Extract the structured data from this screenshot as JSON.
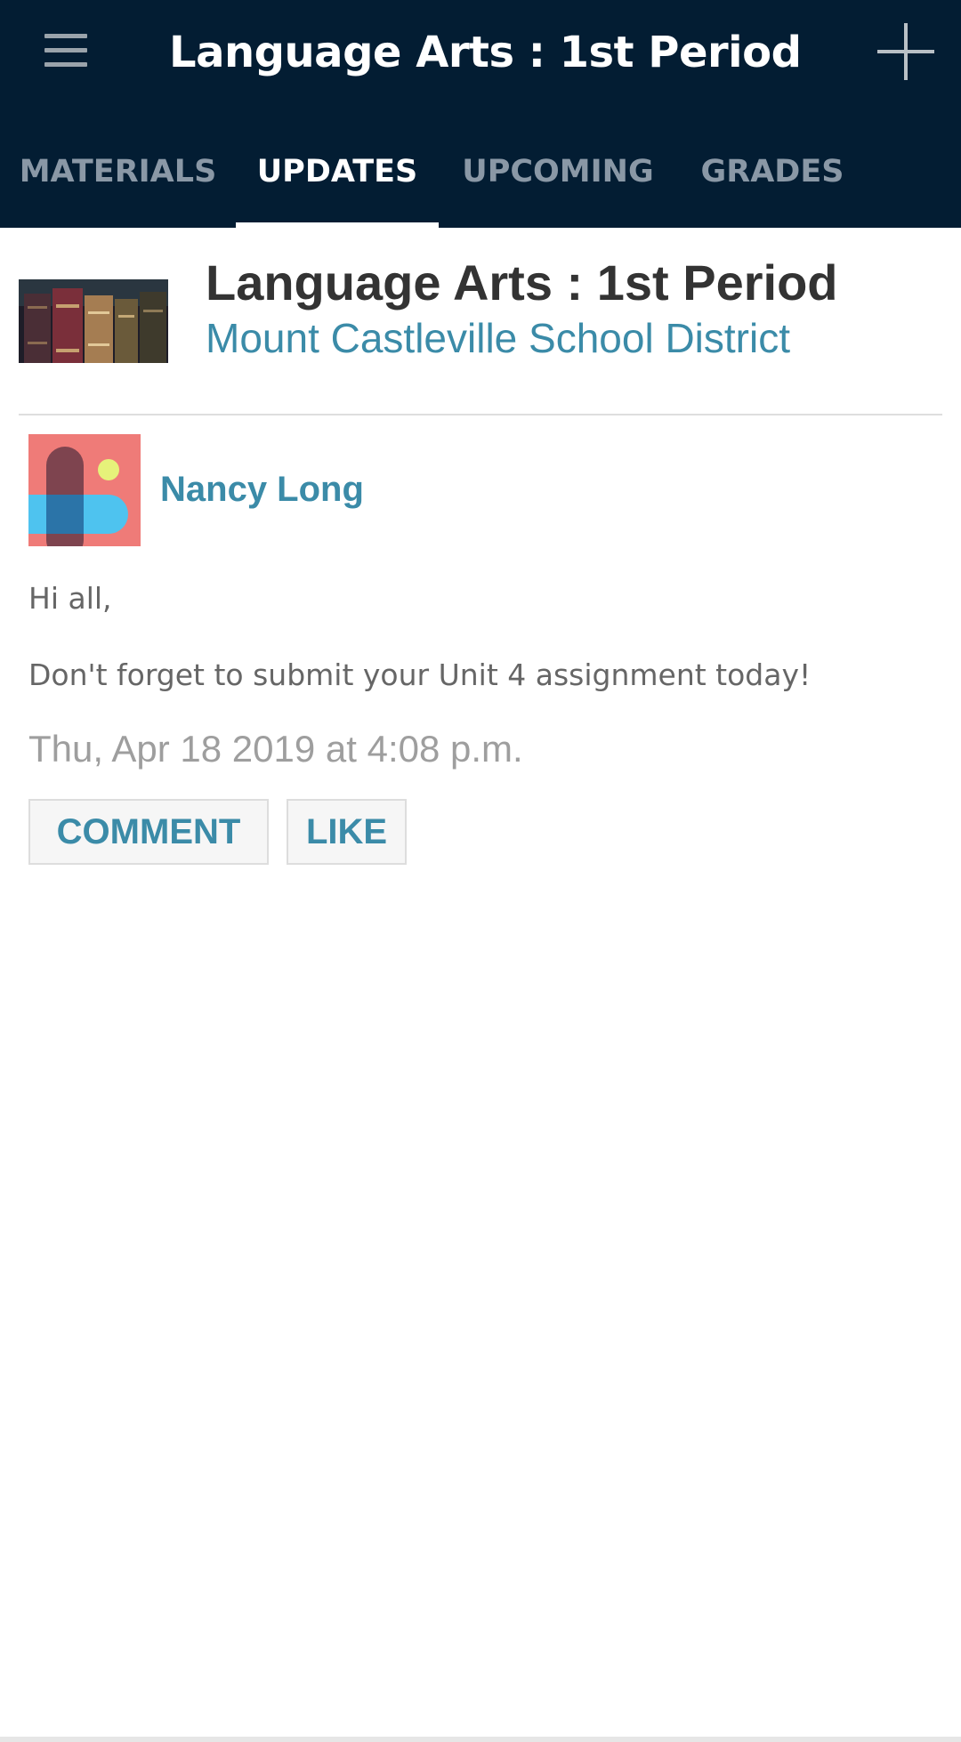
{
  "colors": {
    "app_bar": "#031d33",
    "accent": "#3b8ba8",
    "tab_inactive": "#8a98a6",
    "tab_active": "#ffffff",
    "body_text": "#666666",
    "timestamp": "#9e9e9e",
    "title_text": "#333333"
  },
  "toolbar": {
    "title": "Language Arts : 1st Period",
    "menu_icon": "hamburger-menu-icon",
    "add_icon": "plus-icon"
  },
  "tabs": [
    {
      "label": "MATERIALS",
      "active": false
    },
    {
      "label": "UPDATES",
      "active": true
    },
    {
      "label": "UPCOMING",
      "active": false
    },
    {
      "label": "GRADES",
      "active": false
    }
  ],
  "course": {
    "title": "Language Arts : 1st Period",
    "subtitle": "Mount Castleville School District",
    "thumbnail": "books-image"
  },
  "post": {
    "author": "Nancy Long",
    "avatar": "author-avatar-image",
    "greeting": "Hi all,",
    "message": "Don't forget to submit your Unit 4 assignment today!",
    "timestamp": "Thu, Apr 18 2019 at 4:08 p.m.",
    "comment_label": "COMMENT",
    "like_label": "LIKE"
  }
}
